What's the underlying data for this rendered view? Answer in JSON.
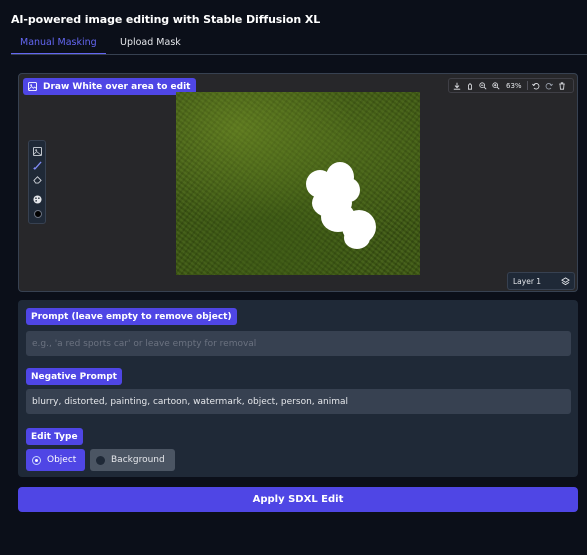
{
  "app": {
    "title": "AI-powered image editing with Stable Diffusion XL"
  },
  "tabs": [
    {
      "label": "Manual Masking",
      "active": true
    },
    {
      "label": "Upload Mask",
      "active": false
    }
  ],
  "editor": {
    "label": "Draw White over area to edit",
    "zoom": "63%",
    "layer": "Layer 1",
    "left_tools": [
      "image-icon",
      "brush-icon",
      "eraser-icon",
      "palette-icon",
      "color-swatch"
    ],
    "top_tools": [
      "download-icon",
      "pan-icon",
      "zoom-out-icon",
      "zoom-in-icon",
      "undo-icon",
      "redo-icon",
      "trash-icon"
    ]
  },
  "form": {
    "prompt": {
      "label": "Prompt (leave empty to remove object)",
      "placeholder": "e.g., 'a red sports car' or leave empty for removal",
      "value": ""
    },
    "negative_prompt": {
      "label": "Negative Prompt",
      "value": "blurry, distorted, painting, cartoon, watermark, object, person, animal"
    },
    "edit_type": {
      "label": "Edit Type",
      "options": [
        "Object",
        "Background"
      ],
      "selected": "Object"
    }
  },
  "actions": {
    "apply_label": "Apply SDXL Edit"
  },
  "colors": {
    "accent": "#4f46e5",
    "background": "#0b0f19",
    "panel": "#1f2937"
  }
}
